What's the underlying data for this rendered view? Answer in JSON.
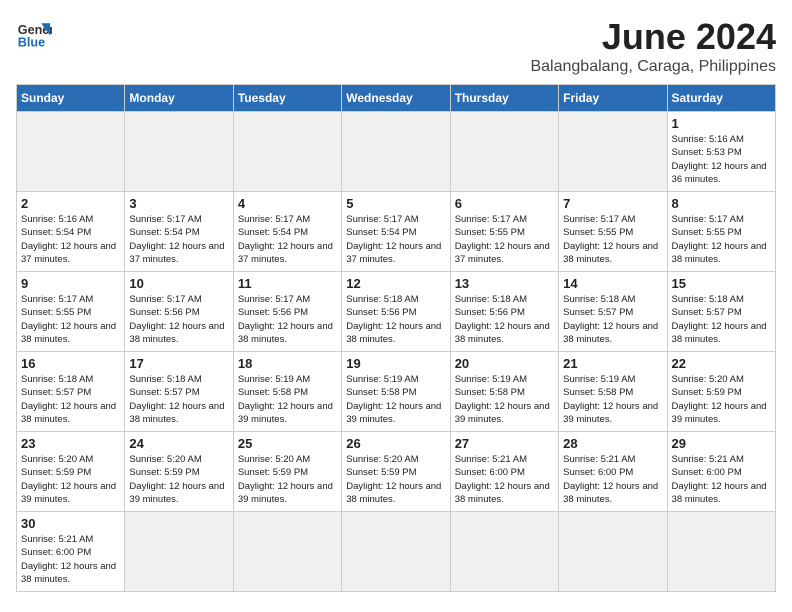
{
  "header": {
    "logo_general": "General",
    "logo_blue": "Blue",
    "title": "June 2024",
    "subtitle": "Balangbalang, Caraga, Philippines"
  },
  "weekdays": [
    "Sunday",
    "Monday",
    "Tuesday",
    "Wednesday",
    "Thursday",
    "Friday",
    "Saturday"
  ],
  "weeks": [
    [
      {
        "day": "",
        "info": ""
      },
      {
        "day": "",
        "info": ""
      },
      {
        "day": "",
        "info": ""
      },
      {
        "day": "",
        "info": ""
      },
      {
        "day": "",
        "info": ""
      },
      {
        "day": "",
        "info": ""
      },
      {
        "day": "1",
        "info": "Sunrise: 5:16 AM\nSunset: 5:53 PM\nDaylight: 12 hours and 36 minutes."
      }
    ],
    [
      {
        "day": "2",
        "info": "Sunrise: 5:16 AM\nSunset: 5:54 PM\nDaylight: 12 hours and 37 minutes."
      },
      {
        "day": "3",
        "info": "Sunrise: 5:17 AM\nSunset: 5:54 PM\nDaylight: 12 hours and 37 minutes."
      },
      {
        "day": "4",
        "info": "Sunrise: 5:17 AM\nSunset: 5:54 PM\nDaylight: 12 hours and 37 minutes."
      },
      {
        "day": "5",
        "info": "Sunrise: 5:17 AM\nSunset: 5:54 PM\nDaylight: 12 hours and 37 minutes."
      },
      {
        "day": "6",
        "info": "Sunrise: 5:17 AM\nSunset: 5:55 PM\nDaylight: 12 hours and 37 minutes."
      },
      {
        "day": "7",
        "info": "Sunrise: 5:17 AM\nSunset: 5:55 PM\nDaylight: 12 hours and 38 minutes."
      },
      {
        "day": "8",
        "info": "Sunrise: 5:17 AM\nSunset: 5:55 PM\nDaylight: 12 hours and 38 minutes."
      }
    ],
    [
      {
        "day": "9",
        "info": "Sunrise: 5:17 AM\nSunset: 5:55 PM\nDaylight: 12 hours and 38 minutes."
      },
      {
        "day": "10",
        "info": "Sunrise: 5:17 AM\nSunset: 5:56 PM\nDaylight: 12 hours and 38 minutes."
      },
      {
        "day": "11",
        "info": "Sunrise: 5:17 AM\nSunset: 5:56 PM\nDaylight: 12 hours and 38 minutes."
      },
      {
        "day": "12",
        "info": "Sunrise: 5:18 AM\nSunset: 5:56 PM\nDaylight: 12 hours and 38 minutes."
      },
      {
        "day": "13",
        "info": "Sunrise: 5:18 AM\nSunset: 5:56 PM\nDaylight: 12 hours and 38 minutes."
      },
      {
        "day": "14",
        "info": "Sunrise: 5:18 AM\nSunset: 5:57 PM\nDaylight: 12 hours and 38 minutes."
      },
      {
        "day": "15",
        "info": "Sunrise: 5:18 AM\nSunset: 5:57 PM\nDaylight: 12 hours and 38 minutes."
      }
    ],
    [
      {
        "day": "16",
        "info": "Sunrise: 5:18 AM\nSunset: 5:57 PM\nDaylight: 12 hours and 38 minutes."
      },
      {
        "day": "17",
        "info": "Sunrise: 5:18 AM\nSunset: 5:57 PM\nDaylight: 12 hours and 38 minutes."
      },
      {
        "day": "18",
        "info": "Sunrise: 5:19 AM\nSunset: 5:58 PM\nDaylight: 12 hours and 39 minutes."
      },
      {
        "day": "19",
        "info": "Sunrise: 5:19 AM\nSunset: 5:58 PM\nDaylight: 12 hours and 39 minutes."
      },
      {
        "day": "20",
        "info": "Sunrise: 5:19 AM\nSunset: 5:58 PM\nDaylight: 12 hours and 39 minutes."
      },
      {
        "day": "21",
        "info": "Sunrise: 5:19 AM\nSunset: 5:58 PM\nDaylight: 12 hours and 39 minutes."
      },
      {
        "day": "22",
        "info": "Sunrise: 5:20 AM\nSunset: 5:59 PM\nDaylight: 12 hours and 39 minutes."
      }
    ],
    [
      {
        "day": "23",
        "info": "Sunrise: 5:20 AM\nSunset: 5:59 PM\nDaylight: 12 hours and 39 minutes."
      },
      {
        "day": "24",
        "info": "Sunrise: 5:20 AM\nSunset: 5:59 PM\nDaylight: 12 hours and 39 minutes."
      },
      {
        "day": "25",
        "info": "Sunrise: 5:20 AM\nSunset: 5:59 PM\nDaylight: 12 hours and 39 minutes."
      },
      {
        "day": "26",
        "info": "Sunrise: 5:20 AM\nSunset: 5:59 PM\nDaylight: 12 hours and 38 minutes."
      },
      {
        "day": "27",
        "info": "Sunrise: 5:21 AM\nSunset: 6:00 PM\nDaylight: 12 hours and 38 minutes."
      },
      {
        "day": "28",
        "info": "Sunrise: 5:21 AM\nSunset: 6:00 PM\nDaylight: 12 hours and 38 minutes."
      },
      {
        "day": "29",
        "info": "Sunrise: 5:21 AM\nSunset: 6:00 PM\nDaylight: 12 hours and 38 minutes."
      }
    ],
    [
      {
        "day": "30",
        "info": "Sunrise: 5:21 AM\nSunset: 6:00 PM\nDaylight: 12 hours and 38 minutes."
      },
      {
        "day": "",
        "info": ""
      },
      {
        "day": "",
        "info": ""
      },
      {
        "day": "",
        "info": ""
      },
      {
        "day": "",
        "info": ""
      },
      {
        "day": "",
        "info": ""
      },
      {
        "day": "",
        "info": ""
      }
    ]
  ]
}
